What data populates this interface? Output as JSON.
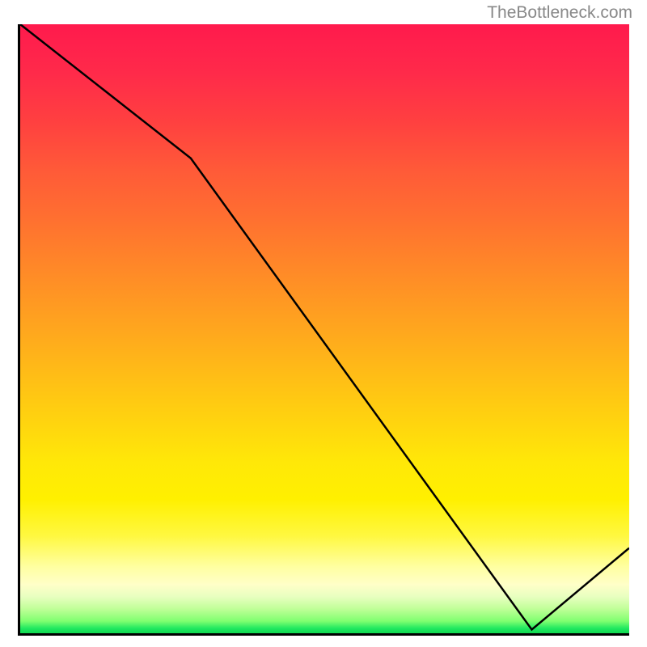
{
  "watermark": "TheBottleneck.com",
  "chart_data": {
    "type": "line",
    "title": "",
    "xlabel": "",
    "ylabel": "",
    "xlim": [
      0,
      100
    ],
    "ylim": [
      0,
      100
    ],
    "x": [
      0,
      28,
      84,
      100
    ],
    "values": [
      100,
      78,
      0.6,
      14
    ],
    "annotation": {
      "text": ""
    }
  },
  "colors": {
    "gradient_top": "#ff1a4d",
    "gradient_mid": "#ffd700",
    "gradient_bottom": "#20e860",
    "line": "#000000",
    "border": "#000000"
  }
}
